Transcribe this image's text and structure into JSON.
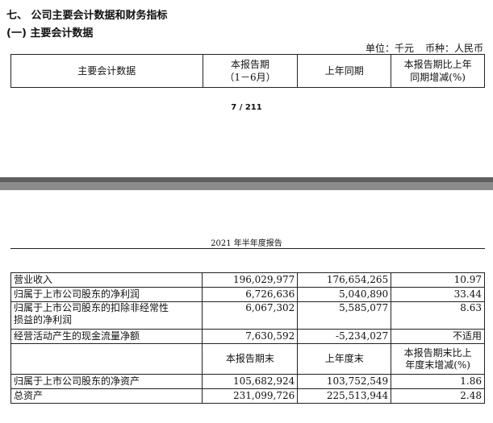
{
  "section": {
    "title": "七、 公司主要会计数据和财务指标",
    "subtitle": "(一) 主要会计数据"
  },
  "unit_line": {
    "unit": "单位：千元",
    "currency": "币种：人民币"
  },
  "header_table": {
    "col1": "主要会计数据",
    "col2_line1": "本报告期",
    "col2_line2": "（1－6月）",
    "col3": "上年同期",
    "col4_line1": "本报告期比上年",
    "col4_line2": "同期增减(%)"
  },
  "page_number": "7 / 211",
  "running_header": "2021 年半年度报告",
  "rows": [
    {
      "label": "营业收入",
      "current": "196,029,977",
      "prior": "176,654,265",
      "change": "10.97"
    },
    {
      "label": "归属于上市公司股东的净利润",
      "current": "6,726,636",
      "prior": "5,040,890",
      "change": "33.44"
    },
    {
      "label_line1": "归属于上市公司股东的扣除非经常性",
      "label_line2": "损益的净利润",
      "current": "6,067,302",
      "prior": "5,585,077",
      "change": "8.63"
    },
    {
      "label": "经营活动产生的现金流量净额",
      "current": "7,630,592",
      "prior": "-5,234,027",
      "change": "不适用"
    }
  ],
  "balance_header": {
    "col2": "本报告期末",
    "col3": "上年度末",
    "col4_line1": "本报告期末比上",
    "col4_line2": "年度末增减(%)"
  },
  "balance_rows": [
    {
      "label": "归属于上市公司股东的净资产",
      "current": "105,682,924",
      "prior": "103,752,549",
      "change": "1.86"
    },
    {
      "label": "总资产",
      "current": "231,099,726",
      "prior": "225,513,944",
      "change": "2.48"
    }
  ]
}
